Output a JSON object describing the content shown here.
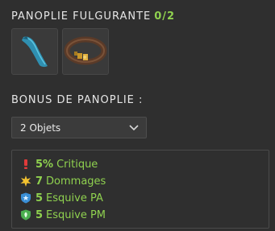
{
  "panoply": {
    "name": "PANOPLIE FULGURANTE",
    "count": "0/2"
  },
  "items": [
    {
      "icon": "cape-icon"
    },
    {
      "icon": "belt-icon"
    }
  ],
  "bonus": {
    "heading": "BONUS DE PANOPLIE :",
    "selected_option": "2 Objets",
    "effects": [
      {
        "icon": "critical-icon",
        "value": "5%",
        "label": "Critique"
      },
      {
        "icon": "damage-icon",
        "value": "7",
        "label": "Dommages"
      },
      {
        "icon": "dodge-pa-icon",
        "value": "5",
        "label": "Esquive PA"
      },
      {
        "icon": "dodge-pm-icon",
        "value": "5",
        "label": "Esquive PM"
      }
    ]
  },
  "colors": {
    "background": "#2f2f2f",
    "accent_green": "#8fd14f",
    "critical_red": "#e03a3a",
    "damage_yellow": "#f2c230",
    "pa_blue": "#3a8fd6",
    "pm_green": "#4caf50"
  }
}
